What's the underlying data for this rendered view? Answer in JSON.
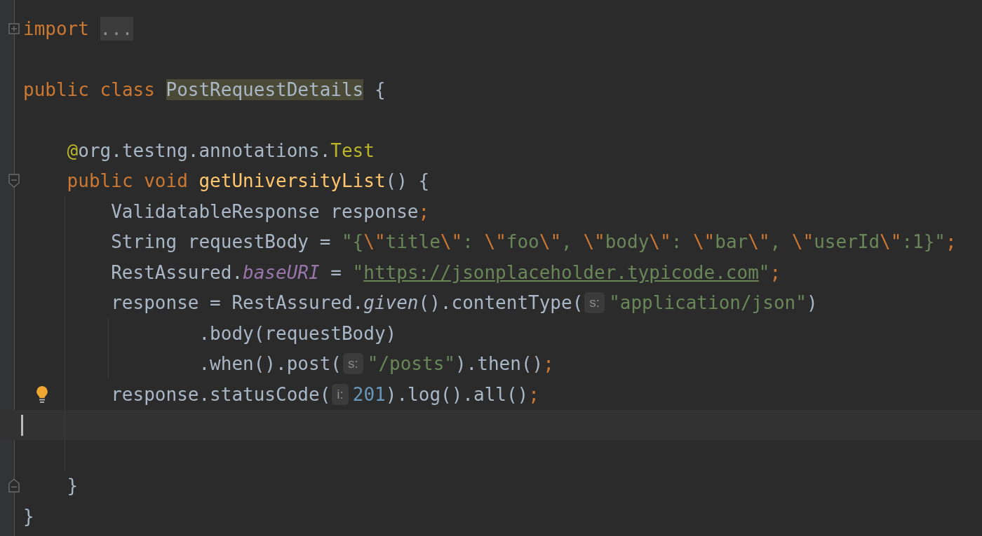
{
  "editor": {
    "lines": [
      {
        "kind": "top",
        "collapsed": true,
        "tokens": [
          {
            "kind": "kw",
            "text": "import"
          },
          {
            "kind": "folded",
            "text": "..."
          }
        ]
      },
      {
        "kind": "top"
      },
      {
        "kind": "top",
        "tokens": [
          {
            "kind": "kw",
            "text": "public class "
          },
          {
            "kind": "highlight",
            "text": "PostRequestDetails"
          },
          {
            "kind": "plain",
            "text": " {"
          }
        ]
      },
      {
        "kind": "top"
      },
      {
        "kind": "member",
        "tokens": [
          {
            "kind": "annotation",
            "text": "@"
          },
          {
            "kind": "plain",
            "text": "org.testng.annotations."
          },
          {
            "kind": "annotation",
            "text": "Test"
          }
        ]
      },
      {
        "kind": "member",
        "fold_start": true,
        "tokens": [
          {
            "kind": "kw",
            "text": "public void "
          },
          {
            "kind": "method",
            "text": "getUniversityList"
          },
          {
            "kind": "plain",
            "text": "() {"
          }
        ]
      },
      {
        "kind": "statement",
        "tokens": [
          {
            "kind": "plain",
            "text": "ValidatableResponse response"
          },
          {
            "kind": "kw",
            "text": ";"
          }
        ]
      },
      {
        "kind": "statement",
        "tokens": [
          {
            "kind": "plain",
            "text": "String requestBody = "
          },
          {
            "kind": "str",
            "text": "\"{"
          },
          {
            "kind": "esc",
            "text": "\\\""
          },
          {
            "kind": "str",
            "text": "title"
          },
          {
            "kind": "esc",
            "text": "\\\""
          },
          {
            "kind": "str",
            "text": ": "
          },
          {
            "kind": "esc",
            "text": "\\\""
          },
          {
            "kind": "str",
            "text": "foo"
          },
          {
            "kind": "esc",
            "text": "\\\""
          },
          {
            "kind": "str",
            "text": ", "
          },
          {
            "kind": "esc",
            "text": "\\\""
          },
          {
            "kind": "str",
            "text": "body"
          },
          {
            "kind": "esc",
            "text": "\\\""
          },
          {
            "kind": "str",
            "text": ": "
          },
          {
            "kind": "esc",
            "text": "\\\""
          },
          {
            "kind": "str",
            "text": "bar"
          },
          {
            "kind": "esc",
            "text": "\\\""
          },
          {
            "kind": "str",
            "text": ", "
          },
          {
            "kind": "esc",
            "text": "\\\""
          },
          {
            "kind": "str",
            "text": "userId"
          },
          {
            "kind": "esc",
            "text": "\\\""
          },
          {
            "kind": "str",
            "text": ":1}\""
          },
          {
            "kind": "kw",
            "text": ";"
          }
        ]
      },
      {
        "kind": "statement",
        "tokens": [
          {
            "kind": "plain",
            "text": "RestAssured."
          },
          {
            "kind": "field",
            "text": "baseURI"
          },
          {
            "kind": "plain",
            "text": " = "
          },
          {
            "kind": "str",
            "text": "\""
          },
          {
            "kind": "link",
            "text": "https://jsonplaceholder.typicode.com"
          },
          {
            "kind": "str",
            "text": "\""
          },
          {
            "kind": "kw",
            "text": ";"
          }
        ]
      },
      {
        "kind": "statement",
        "tokens": [
          {
            "kind": "plain",
            "text": "response = RestAssured."
          },
          {
            "kind": "static",
            "text": "given"
          },
          {
            "kind": "plain",
            "text": "().contentType("
          },
          {
            "kind": "hint",
            "text": "s:"
          },
          {
            "kind": "str",
            "text": "\"application/json\""
          },
          {
            "kind": "plain",
            "text": ")"
          }
        ]
      },
      {
        "kind": "continuation",
        "tokens": [
          {
            "kind": "plain",
            "text": ".body(requestBody)"
          }
        ]
      },
      {
        "kind": "continuation",
        "tokens": [
          {
            "kind": "plain",
            "text": ".when().post("
          },
          {
            "kind": "hint",
            "text": "s:"
          },
          {
            "kind": "str",
            "text": "\"/posts\""
          },
          {
            "kind": "plain",
            "text": ").then()"
          },
          {
            "kind": "kw",
            "text": ";"
          }
        ]
      },
      {
        "kind": "statement",
        "bulb": true,
        "tokens": [
          {
            "kind": "plain",
            "text": "response.statusCode("
          },
          {
            "kind": "hint",
            "text": "i:"
          },
          {
            "kind": "num",
            "text": "201"
          },
          {
            "kind": "plain",
            "text": ").log().all()"
          },
          {
            "kind": "kw",
            "text": ";"
          }
        ]
      },
      {
        "kind": "statement",
        "current": true
      },
      {
        "kind": "statement"
      },
      {
        "kind": "member",
        "fold_end": true,
        "tokens": [
          {
            "kind": "plain",
            "text": "}"
          }
        ]
      },
      {
        "kind": "top",
        "tokens": [
          {
            "kind": "plain",
            "text": "}"
          }
        ]
      }
    ]
  }
}
